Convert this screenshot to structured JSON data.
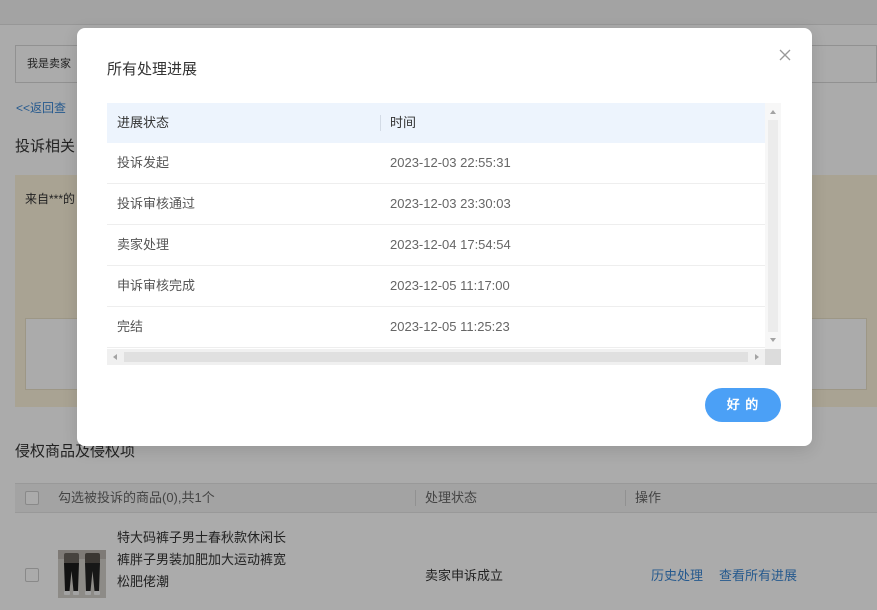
{
  "background_page": {
    "role_label": "我是卖家",
    "back_link": "<<返回查",
    "complaint_section_title": "投诉相关",
    "notice": {
      "text": "来自***的"
    },
    "goods_section_title": "侵权商品及侵权项",
    "goods_table": {
      "header": {
        "select_label": "勾选被投诉的商品(0),共1个",
        "status": "处理状态",
        "actions": "操作"
      },
      "rows": [
        {
          "checked": false,
          "title": "特大码裤子男士春秋款休闲长裤胖子男装加肥加大运动裤宽松肥佬潮",
          "status": "卖家申诉成立",
          "actions": [
            "历史处理",
            "查看所有进展"
          ]
        }
      ]
    }
  },
  "modal": {
    "title": "所有处理进展",
    "close_icon": "close-icon",
    "progress_table": {
      "columns": [
        "进展状态",
        "时间"
      ],
      "rows": [
        {
          "status": "投诉发起",
          "time": "2023-12-03 22:55:31"
        },
        {
          "status": "投诉审核通过",
          "time": "2023-12-03 23:30:03"
        },
        {
          "status": "卖家处理",
          "time": "2023-12-04 17:54:54"
        },
        {
          "status": "申诉审核完成",
          "time": "2023-12-05 11:17:00"
        },
        {
          "status": "完结",
          "time": "2023-12-05 11:25:23"
        }
      ]
    },
    "confirm_label": "好 的"
  },
  "colors": {
    "accent": "#4ba0f6",
    "link": "#3a86d4",
    "overlay": "rgba(0,0,0,0.33)",
    "progress_header_bg": "#edf4fd",
    "notice_bg": "#fcf3dc"
  }
}
